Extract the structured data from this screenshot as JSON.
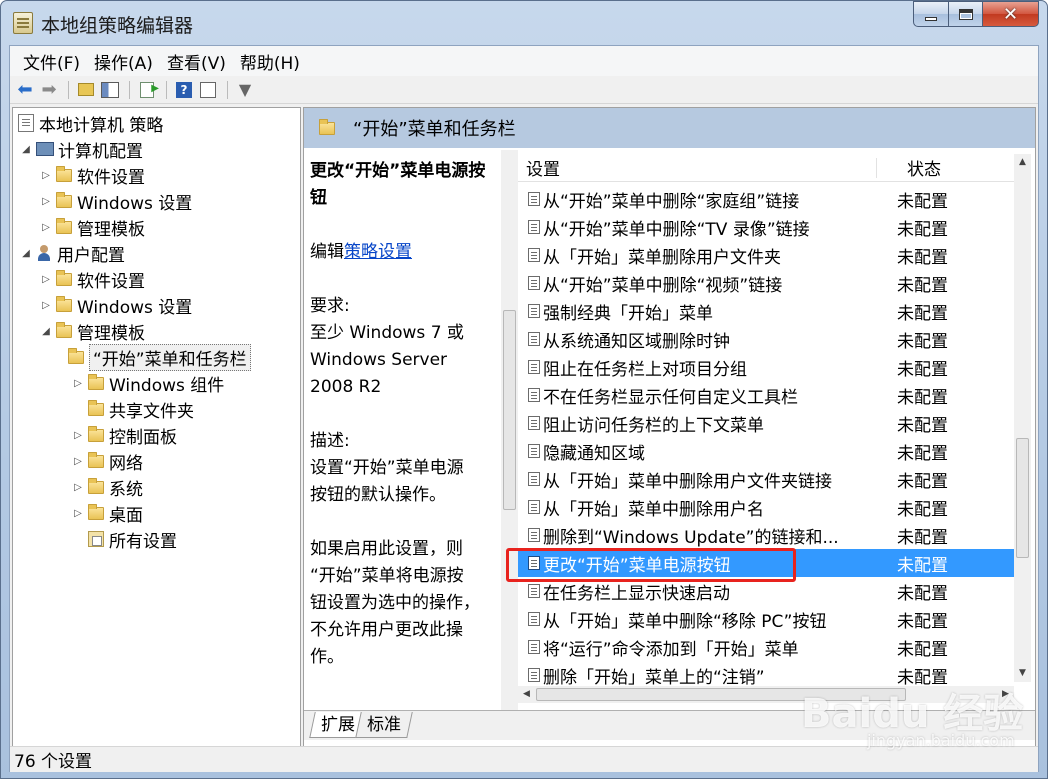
{
  "window": {
    "title": "本地组策略编辑器"
  },
  "menu": [
    "文件(F)",
    "操作(A)",
    "查看(V)",
    "帮助(H)"
  ],
  "toolbar": {
    "icons": [
      "back-arrow-icon",
      "forward-arrow-icon",
      "folder-up-icon",
      "show-tree-icon",
      "export-list-icon",
      "help-icon",
      "properties-icon",
      "filter-icon"
    ]
  },
  "tree": {
    "root": "本地计算机 策略",
    "computer_config": "计算机配置",
    "software_settings_1": "软件设置",
    "windows_settings_1": "Windows 设置",
    "admin_templates_1": "管理模板",
    "user_config": "用户配置",
    "software_settings_2": "软件设置",
    "windows_settings_2": "Windows 设置",
    "admin_templates_2": "管理模板",
    "start_menu_taskbar": "“开始”菜单和任务栏",
    "windows_components": "Windows 组件",
    "shared_folders": "共享文件夹",
    "control_panel": "控制面板",
    "network": "网络",
    "system": "系统",
    "desktop": "桌面",
    "all_settings": "所有设置"
  },
  "right": {
    "header": "“开始”菜单和任务栏",
    "desc": {
      "title_1": "更改“开始”菜单电源按",
      "title_2": "钮",
      "edit_prefix": "编辑",
      "edit_link": "策略设置",
      "req_label": "要求:",
      "req_1": "至少 Windows 7 或",
      "req_2": "Windows Server",
      "req_3": "2008 R2",
      "desc_label": "描述:",
      "desc_1": "设置“开始”菜单电源",
      "desc_2": "按钮的默认操作。",
      "more_1": "如果启用此设置，则",
      "more_2": "“开始”菜单将电源按",
      "more_3": "钮设置为选中的操作，",
      "more_4": "不允许用户更改此操",
      "more_5": "作。"
    },
    "columns": {
      "setting": "设置",
      "state": "状态"
    },
    "rows": [
      {
        "name": "从“开始”菜单中删除“家庭组”链接",
        "state": "未配置"
      },
      {
        "name": "从“开始”菜单中删除“TV 录像”链接",
        "state": "未配置"
      },
      {
        "name": "从「开始」菜单删除用户文件夹",
        "state": "未配置"
      },
      {
        "name": "从“开始”菜单中删除“视频”链接",
        "state": "未配置"
      },
      {
        "name": "强制经典「开始」菜单",
        "state": "未配置"
      },
      {
        "name": "从系统通知区域删除时钟",
        "state": "未配置"
      },
      {
        "name": "阻止在任务栏上对项目分组",
        "state": "未配置"
      },
      {
        "name": "不在任务栏显示任何自定义工具栏",
        "state": "未配置"
      },
      {
        "name": "阻止访问任务栏的上下文菜单",
        "state": "未配置"
      },
      {
        "name": "隐藏通知区域",
        "state": "未配置"
      },
      {
        "name": "从「开始」菜单中删除用户文件夹链接",
        "state": "未配置"
      },
      {
        "name": "从「开始」菜单中删除用户名",
        "state": "未配置"
      },
      {
        "name": "删除到“Windows Update”的链接和...",
        "state": "未配置"
      },
      {
        "name": "更改“开始”菜单电源按钮",
        "state": "未配置"
      },
      {
        "name": "在任务栏上显示快速启动",
        "state": "未配置"
      },
      {
        "name": "从「开始」菜单中删除“移除 PC”按钮",
        "state": "未配置"
      },
      {
        "name": "将“运行”命令添加到「开始」菜单",
        "state": "未配置"
      },
      {
        "name": "删除「开始」菜单上的“注销”",
        "state": "未配置"
      }
    ],
    "selected_row_index": 13,
    "tabs": [
      "扩展",
      "标准"
    ]
  },
  "status": "76 个设置",
  "watermark": {
    "main": "Baidu 经验",
    "sub": "jingyan.baidu.com"
  },
  "colors": {
    "selection": "#3399ff",
    "header_band": "#b6c9e0",
    "highlight_box": "#e8231e"
  }
}
